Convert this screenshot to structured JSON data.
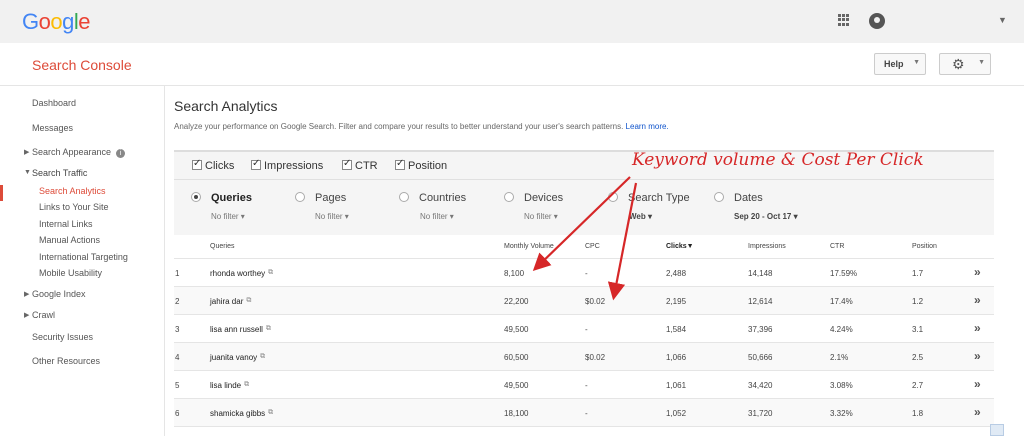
{
  "header": {
    "logo_letters": [
      {
        "ch": "G",
        "color": "#4285f4"
      },
      {
        "ch": "o",
        "color": "#ea4335"
      },
      {
        "ch": "o",
        "color": "#fbbc05"
      },
      {
        "ch": "g",
        "color": "#4285f4"
      },
      {
        "ch": "l",
        "color": "#34a853"
      },
      {
        "ch": "e",
        "color": "#ea4335"
      }
    ],
    "product": "Search Console",
    "help_label": "Help",
    "apps_icon": "apps-grid-icon",
    "account_icon": "account-icon"
  },
  "sidebar": {
    "items": [
      {
        "label": "Dashboard"
      },
      {
        "label": "Messages"
      },
      {
        "label": "Search Appearance"
      },
      {
        "label": "Search Traffic"
      },
      {
        "label": "Search Analytics"
      },
      {
        "label": "Links to Your Site"
      },
      {
        "label": "Internal Links"
      },
      {
        "label": "Manual Actions"
      },
      {
        "label": "International Targeting"
      },
      {
        "label": "Mobile Usability"
      },
      {
        "label": "Google Index"
      },
      {
        "label": "Crawl"
      },
      {
        "label": "Security Issues"
      },
      {
        "label": "Other Resources"
      }
    ],
    "info_glyph": "i"
  },
  "main": {
    "title": "Search Analytics",
    "description": "Analyze your performance on Google Search. Filter and compare your results to better understand your user's search patterns.",
    "learn_more": "Learn more.",
    "metrics": [
      "Clicks",
      "Impressions",
      "CTR",
      "Position"
    ],
    "dimensions": [
      {
        "label": "Queries",
        "filter": "No filter"
      },
      {
        "label": "Pages",
        "filter": "No filter"
      },
      {
        "label": "Countries",
        "filter": "No filter"
      },
      {
        "label": "Devices",
        "filter": "No filter"
      },
      {
        "label": "Search Type",
        "filter": "Web"
      },
      {
        "label": "Dates",
        "filter": "Sep 20 - Oct 17"
      }
    ]
  },
  "table": {
    "headers": {
      "queries": "Queries",
      "volume": "Monthly Volume",
      "cpc": "CPC",
      "clicks": "Clicks▼",
      "impressions": "Impressions",
      "ctr": "CTR",
      "position": "Position"
    },
    "rows": [
      {
        "n": "1",
        "query": "rhonda worthey",
        "volume": "8,100",
        "cpc": "-",
        "clicks": "2,488",
        "impressions": "14,148",
        "ctr": "17.59%",
        "position": "1.7"
      },
      {
        "n": "2",
        "query": "jahira dar",
        "volume": "22,200",
        "cpc": "$0.02",
        "clicks": "2,195",
        "impressions": "12,614",
        "ctr": "17.4%",
        "position": "1.2"
      },
      {
        "n": "3",
        "query": "lisa ann russell",
        "volume": "49,500",
        "cpc": "-",
        "clicks": "1,584",
        "impressions": "37,396",
        "ctr": "4.24%",
        "position": "3.1"
      },
      {
        "n": "4",
        "query": "juanita vanoy",
        "volume": "60,500",
        "cpc": "$0.02",
        "clicks": "1,066",
        "impressions": "50,666",
        "ctr": "2.1%",
        "position": "2.5"
      },
      {
        "n": "5",
        "query": "lisa linde",
        "volume": "49,500",
        "cpc": "-",
        "clicks": "1,061",
        "impressions": "34,420",
        "ctr": "3.08%",
        "position": "2.7"
      },
      {
        "n": "6",
        "query": "shamicka gibbs",
        "volume": "18,100",
        "cpc": "-",
        "clicks": "1,052",
        "impressions": "31,720",
        "ctr": "3.32%",
        "position": "1.8"
      }
    ],
    "row_chevron": "»",
    "external_link_glyph": "⧉"
  },
  "annotation": {
    "text": "Keyword volume & Cost Per Click",
    "color": "#d62728"
  }
}
